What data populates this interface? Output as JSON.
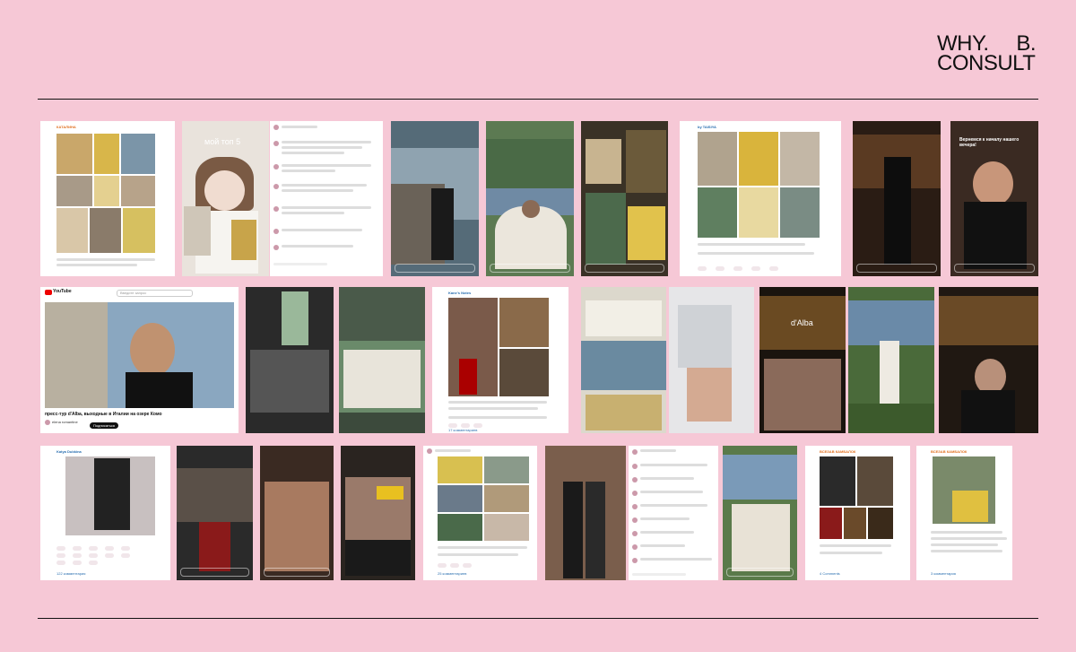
{
  "brand": {
    "line1_left": "WHY.",
    "line1_right": "B.",
    "line2": "CONSULT"
  },
  "cards": {
    "yt_logo": "YouTube",
    "yt_caption": "пресс-тур d'Alba, выходные в Италии на озере Комо",
    "yt_channel": "elena romantine",
    "yt_subscribe": "Подписаться",
    "yt_search": "Введите запрос",
    "poster_top5": "мой топ 5",
    "story_greeting": "Вернемся к началу нашего вечера!",
    "dalba_sign": "d'Alba",
    "tg_header1": "КАТАЛИНА",
    "tg_header2": "by TAISIYA",
    "tg_header3": "Kane's Notes",
    "tg_header4": "Katya Dubkina",
    "tg_header5": "ВСЕЗАВ КАМБАЛОК",
    "comments_1": "17 комментариев",
    "comments_2": "122 комментария",
    "comments_3": "25 комментариев",
    "comments_4": "4 Comments",
    "comments_5": "3 комментария"
  }
}
